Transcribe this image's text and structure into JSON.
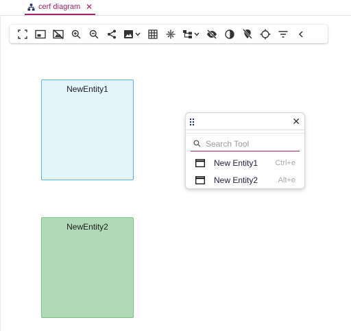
{
  "tabs": [
    {
      "label": "cerf diagram",
      "icon": "diagram-icon",
      "active": true
    }
  ],
  "colors": {
    "accent": "#a31e6a",
    "entity1_fill": "#e4f4fb",
    "entity1_border": "#59b5d9",
    "entity2_fill": "#b0dab5",
    "entity2_border": "#7cc083"
  },
  "toolbar": {
    "buttons": [
      "fit-screen-icon",
      "picture-in-picture-icon",
      "hide-image-icon",
      "zoom-in-icon",
      "zoom-out-icon",
      "share-icon",
      "image-export-icon",
      "grid-icon",
      "center-icon",
      "layout-icon",
      "visibility-off-icon",
      "contrast-icon",
      "location-off-icon",
      "crosshair-icon",
      "filter-icon",
      "collapse-icon"
    ]
  },
  "entities": [
    {
      "name": "NewEntity1"
    },
    {
      "name": "NewEntity2"
    }
  ],
  "palette": {
    "search_placeholder": "Search Tool",
    "items": [
      {
        "label": "New Entity1",
        "shortcut": "Ctrl+e"
      },
      {
        "label": "New Entity2",
        "shortcut": "Alt+e"
      }
    ]
  }
}
